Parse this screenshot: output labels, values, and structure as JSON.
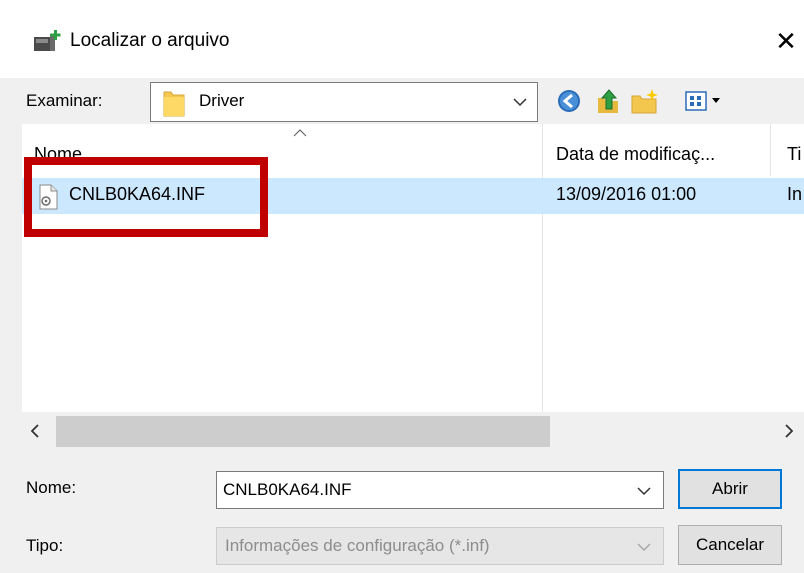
{
  "window": {
    "title": "Localizar o arquivo",
    "close_glyph": "✕",
    "title_icon": "add-printer-driver-icon"
  },
  "lookin": {
    "label": "Examinar:",
    "value": "Driver",
    "icon": "folder-icon"
  },
  "toolbar": {
    "icons": [
      "back-icon",
      "up-folder-icon",
      "new-folder-icon",
      "view-menu-icon"
    ]
  },
  "file_list": {
    "columns": [
      "Nome",
      "Data de modificaç...",
      "Ti"
    ],
    "rows": [
      {
        "name": "CNLB0KA64.INF",
        "date": "13/09/2016 01:00",
        "type": "In",
        "icon": "inf-file-icon",
        "selected": true
      }
    ]
  },
  "footer": {
    "name_label": "Nome:",
    "name_value": "CNLB0KA64.INF",
    "type_label": "Tipo:",
    "type_value": "Informações de configuração (*.inf)",
    "open_button": "Abrir",
    "cancel_button": "Cancelar"
  },
  "colors": {
    "selection": "#cce8ff",
    "highlight_box": "#c00000",
    "accent": "#0078d7"
  }
}
